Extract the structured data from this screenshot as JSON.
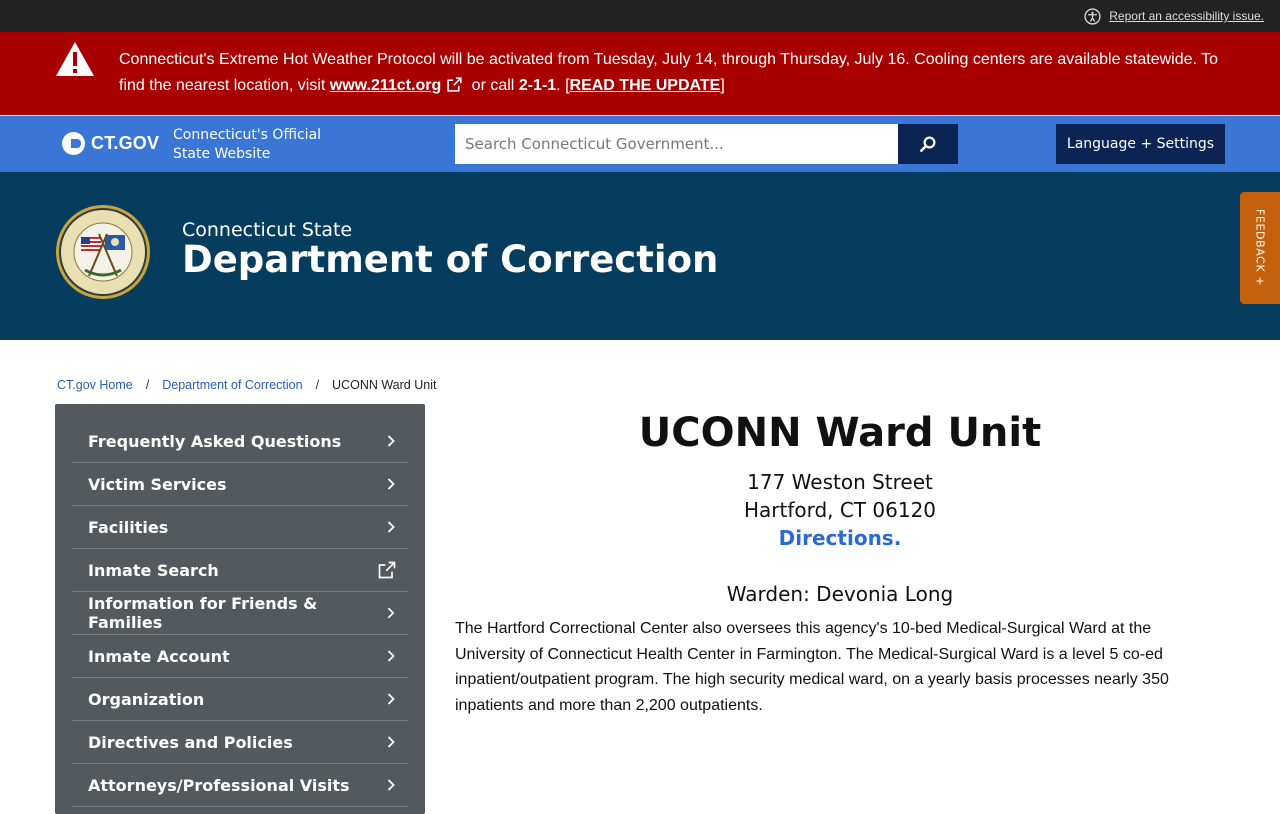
{
  "utility": {
    "accessibility_label": "Report an accessibility issue."
  },
  "alert": {
    "text_before": "Connecticut's Extreme Hot Weather Protocol will be activated from Tuesday, July 14, through Thursday, July 16. Cooling centers are available statewide. To find the nearest location, visit ",
    "link_label": "www.211ct.org",
    "text_mid": " or call ",
    "phone": "2-1-1",
    "text_after": ". [",
    "update_label": "READ THE UPDATE",
    "text_end": "]"
  },
  "ctgov": {
    "logo_text": "CT.GOV",
    "tagline_line1": "Connecticut's Official",
    "tagline_line2": "State Website",
    "search_placeholder": "Search Connecticut Government...",
    "language_label": "Language + Settings"
  },
  "agency": {
    "pre_title": "Connecticut State",
    "name": "Department of Correction"
  },
  "feedback": {
    "label": "FEEDBACK +"
  },
  "breadcrumb": {
    "home": "CT.gov Home",
    "agency": "Department of Correction",
    "current": "UCONN Ward Unit",
    "separator": "/"
  },
  "sidebar": {
    "items": [
      {
        "label": "Frequently Asked Questions",
        "icon": "chevron-right-icon"
      },
      {
        "label": "Victim Services",
        "icon": "chevron-right-icon"
      },
      {
        "label": "Facilities",
        "icon": "chevron-right-icon"
      },
      {
        "label": "Inmate Search",
        "icon": "external-link-icon"
      },
      {
        "label": "Information for Friends & Families",
        "icon": "chevron-right-icon"
      },
      {
        "label": "Inmate Account",
        "icon": "chevron-right-icon"
      },
      {
        "label": "Organization",
        "icon": "chevron-right-icon"
      },
      {
        "label": "Directives and Policies",
        "icon": "chevron-right-icon"
      },
      {
        "label": "Attorneys/Professional Visits",
        "icon": "chevron-right-icon"
      }
    ]
  },
  "main": {
    "title": "UCONN Ward Unit",
    "address_line1": "177 Weston Street",
    "address_line2": "Hartford, CT 06120",
    "directions_label": "Directions.",
    "warden": "Warden: Devonia Long",
    "body": "The Hartford Correctional Center also oversees this agency's 10-bed Medical-Surgical Ward at the University of Connecticut Health Center in Farmington. The Medical-Surgical Ward is a level 5 co-ed inpatient/outpatient program. The high security medical ward, on a yearly basis processes nearly 350 inpatients and more than 2,200 outpatients."
  },
  "colors": {
    "alert_red": "#a80000",
    "ctgov_blue": "#3a76d6",
    "navy": "#0b2454",
    "agency_teal": "#063d5e",
    "sidebar_gray": "#53595c",
    "feedback_orange": "#c5600c",
    "link_blue": "#2a6bd3"
  }
}
